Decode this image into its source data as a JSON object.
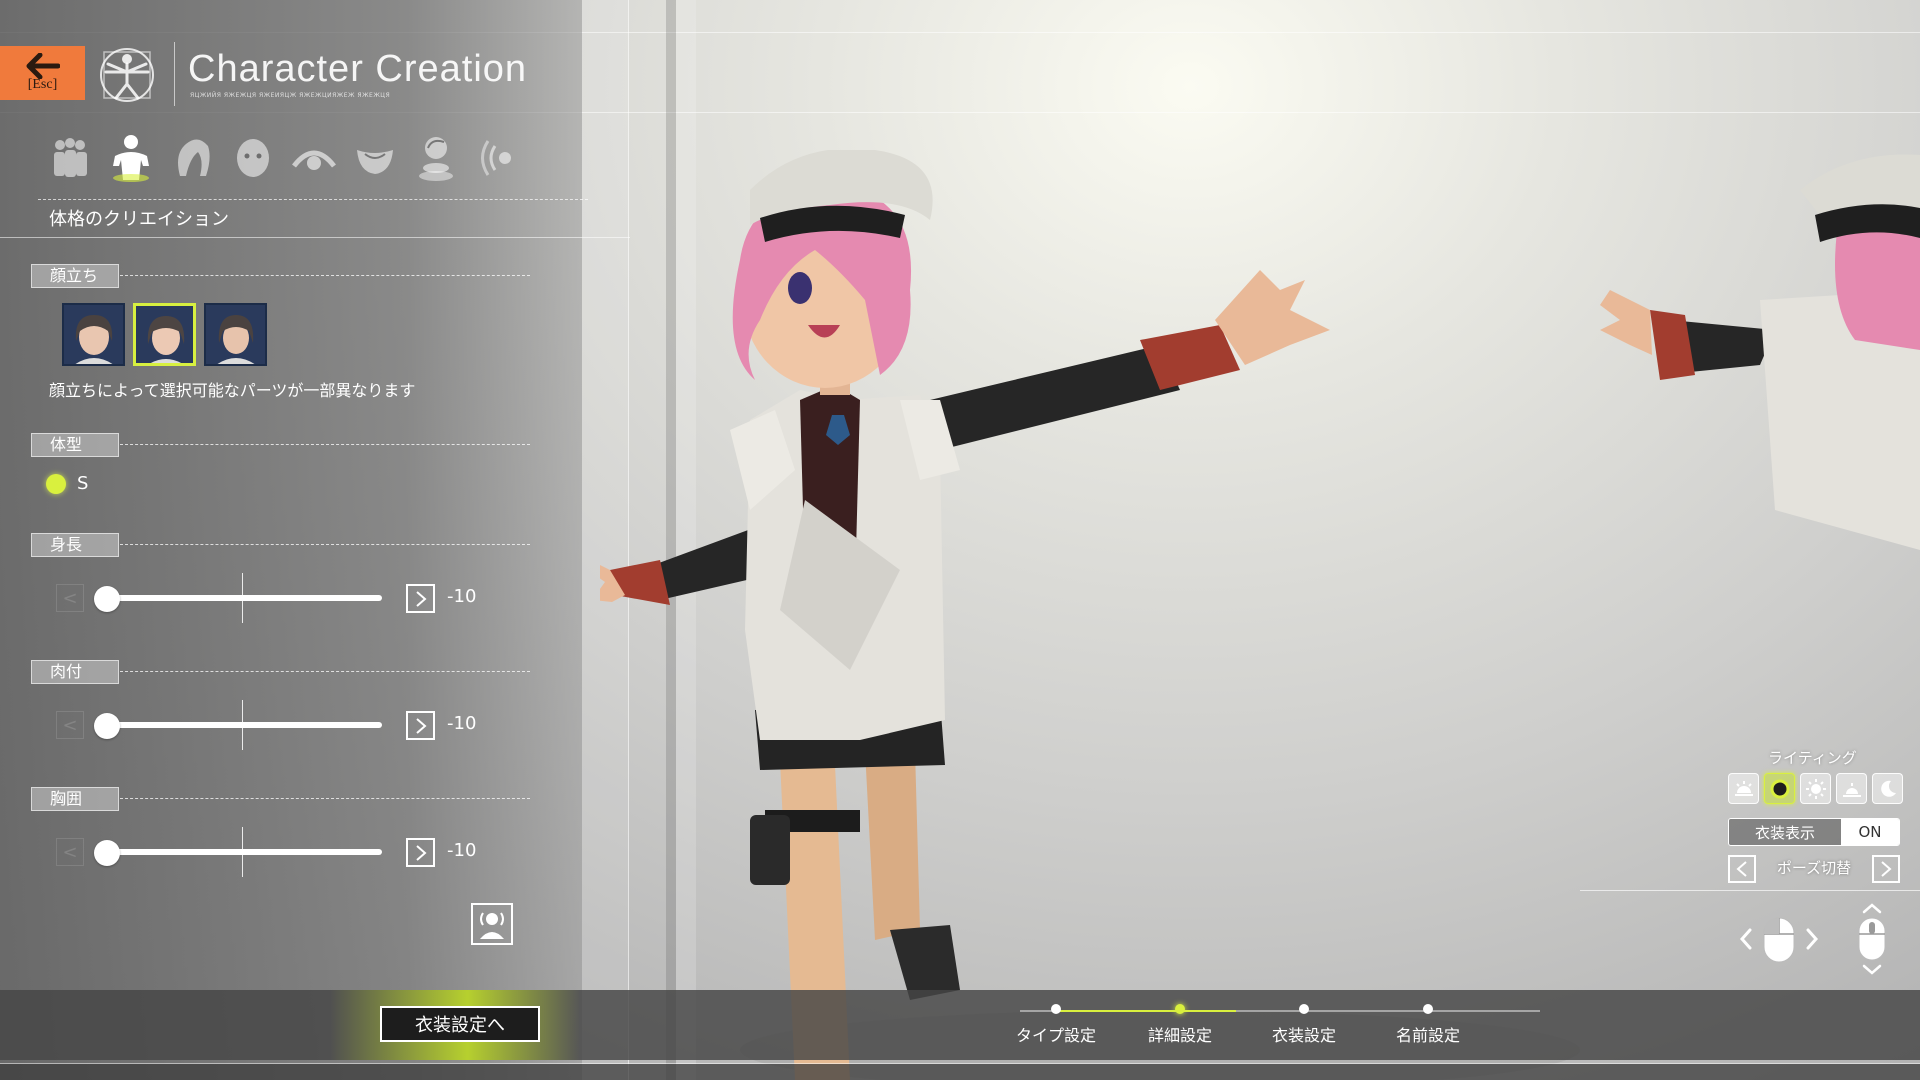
{
  "header": {
    "back_key": "[Esc]",
    "title": "Character Creation",
    "subtitle": "ЯЦЖИЙЯ ЯЖЕЖЦЯ ЯЖЕИЯЦЖ ЯЖЕЖЦИЯЖЕЖ ЯЖЕЖЦЯ"
  },
  "category_tabs": [
    {
      "id": "type",
      "icon": "group-icon",
      "selected": false
    },
    {
      "id": "body",
      "icon": "body-icon",
      "selected": true
    },
    {
      "id": "hair",
      "icon": "hair-icon",
      "selected": false
    },
    {
      "id": "face",
      "icon": "face-icon",
      "selected": false
    },
    {
      "id": "eye",
      "icon": "eye-icon",
      "selected": false
    },
    {
      "id": "mouth",
      "icon": "mouth-icon",
      "selected": false
    },
    {
      "id": "skin",
      "icon": "skin-icon",
      "selected": false
    },
    {
      "id": "voice",
      "icon": "voice-icon",
      "selected": false
    }
  ],
  "section_title": "体格のクリエイション",
  "face_shape": {
    "label": "顔立ち",
    "selected_index": 1,
    "option_count": 3,
    "note": "顔立ちによって選択可能なパーツが一部異なります"
  },
  "body_type": {
    "label": "体型",
    "value": "S"
  },
  "sliders": [
    {
      "id": "height",
      "label": "身長",
      "value": "-10",
      "min": -10,
      "max": 10,
      "current": -10
    },
    {
      "id": "flesh",
      "label": "肉付",
      "value": "-10",
      "min": -10,
      "max": 10,
      "current": -10
    },
    {
      "id": "chest",
      "label": "胸囲",
      "value": "-10",
      "min": -10,
      "max": 10,
      "current": -10
    }
  ],
  "next_button": "衣装設定へ",
  "steps": [
    {
      "label": "タイプ設定",
      "active": false
    },
    {
      "label": "詳細設定",
      "active": true
    },
    {
      "label": "衣装設定",
      "active": false
    },
    {
      "label": "名前設定",
      "active": false
    }
  ],
  "lighting": {
    "label": "ライティング",
    "options": [
      "morning-sun-icon",
      "noon-icon",
      "bright-sun-icon",
      "sunset-icon",
      "moon-icon"
    ],
    "selected_index": 1
  },
  "outfit_display": {
    "label": "衣装表示",
    "state": "ON"
  },
  "pose_switch": {
    "label": "ポーズ切替"
  },
  "colors": {
    "accent": "#d9f03e",
    "back_button": "#f07a3c",
    "hair": "#e58ab0",
    "hat": "#dcdbd4",
    "jacket": "#e4e2dc",
    "sleeve": "#262626",
    "glove_cuff": "#a23d2f"
  }
}
